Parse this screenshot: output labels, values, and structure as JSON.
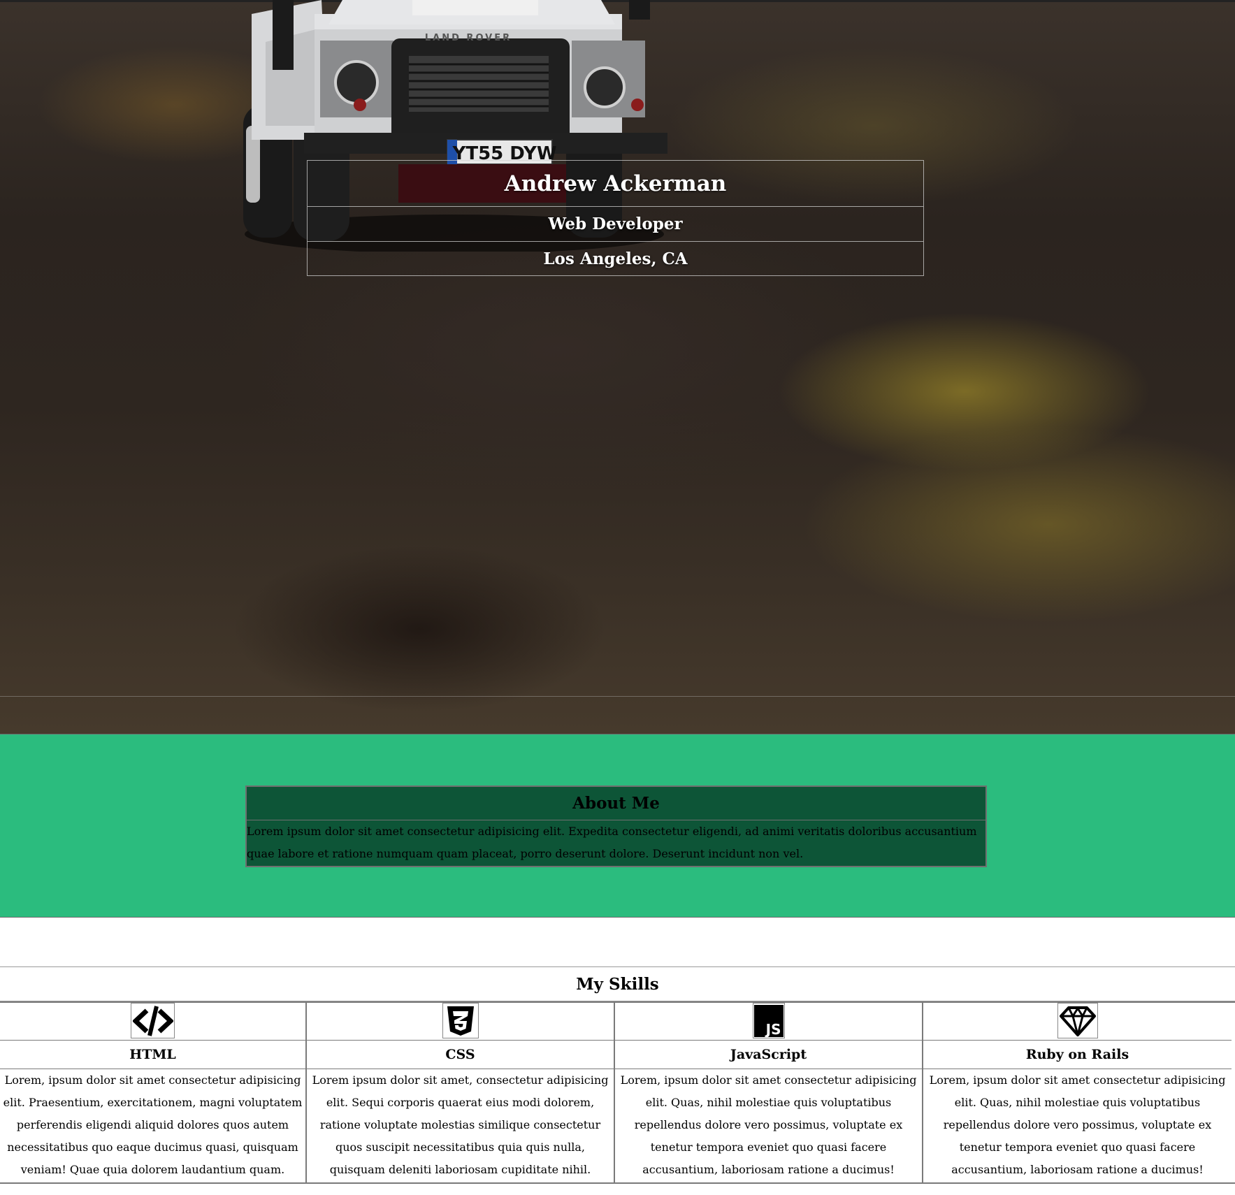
{
  "hero": {
    "name": "Andrew Ackerman",
    "title": "Web Developer",
    "location": "Los Angeles, CA",
    "truck_badge": "LAND ROVER",
    "license_plate": "YT55 DYW"
  },
  "about": {
    "heading": "About Me",
    "text": "Lorem ipsum dolor sit amet consectetur adipisicing elit. Expedita consectetur eligendi, ad animi veritatis doloribus accusantium quae labore et ratione numquam quam placeat, porro deserunt dolore. Deserunt incidunt non vel.",
    "bg_color": "#2bbc7e",
    "box_color": "#0d5537"
  },
  "skills": {
    "heading": "My Skills",
    "items": [
      {
        "icon": "code-icon",
        "name": "HTML",
        "text": "Lorem, ipsum dolor sit amet consectetur adipisicing elit. Praesentium, exercitationem, magni voluptatem perferendis eligendi aliquid dolores quos autem necessitatibus quo eaque ducimus quasi, quisquam veniam! Quae quia dolorem laudantium quam."
      },
      {
        "icon": "css3-icon",
        "name": "CSS",
        "text": "Lorem ipsum dolor sit amet, consectetur adipisicing elit. Sequi corporis quaerat eius modi dolorem, ratione voluptate molestias similique consectetur quos suscipit necessitatibus quia quis nulla, quisquam deleniti laboriosam cupiditate nihil."
      },
      {
        "icon": "javascript-icon",
        "icon_text": "JS",
        "name": "JavaScript",
        "text": "Lorem, ipsum dolor sit amet consectetur adipisicing elit. Quas, nihil molestiae quis voluptatibus repellendus dolore vero possimus, voluptate ex tenetur tempora eveniet quo quasi facere accusantium, laboriosam ratione a ducimus!"
      },
      {
        "icon": "gem-icon",
        "name": "Ruby on Rails",
        "text": "Lorem, ipsum dolor sit amet consectetur adipisicing elit. Quas, nihil molestiae quis voluptatibus repellendus dolore vero possimus, voluptate ex tenetur tempora eveniet quo quasi facere accusantium, laboriosam ratione a ducimus!"
      }
    ]
  }
}
